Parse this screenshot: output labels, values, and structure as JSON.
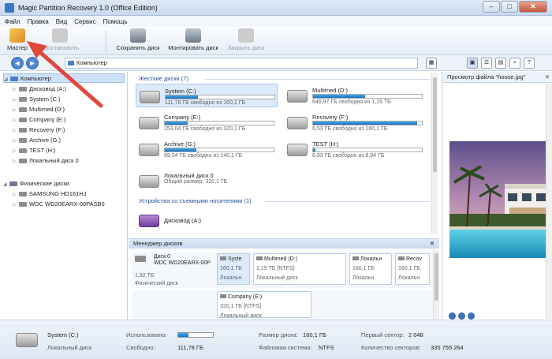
{
  "title": "Magic Partition Recovery 1.0 (Office Edition)",
  "menu": [
    "Файл",
    "Правка",
    "Вид",
    "Сервис",
    "Помощь"
  ],
  "toolbar": {
    "master": "Мастер",
    "restore": "Восстановить",
    "save_disk": "Сохранить диск",
    "mount_disk": "Монтировать диск",
    "close_disk": "Закрыть диск"
  },
  "address": "Компьютер",
  "tree": {
    "computer": "Компьютер",
    "items": [
      "Дисковод (A:)",
      "System (C:)",
      "Multimed (D:)",
      "Company (E:)",
      "Recovery (F:)",
      "Archive (G:)",
      "TEST (H:)",
      "Локальный диск 0"
    ],
    "physical": "Физические диски",
    "physical_items": [
      "SAMSUNG HD161HJ",
      "WDC WD20EARX-00PASB0"
    ]
  },
  "sections": {
    "hard": "Жесткие диски (7)",
    "removable": "Устройства со съемными носителями (1)"
  },
  "drives": [
    {
      "name": "System (C:)",
      "info": "111,78 ГБ свободно из 160,1 ГБ",
      "used": 0.3
    },
    {
      "name": "Multimed (D:)",
      "info": "646,97 ГБ свободно из 1,19 ТБ",
      "used": 0.48
    },
    {
      "name": "Company (E:)",
      "info": "253,04 ГБ свободно из 320,1 ГБ",
      "used": 0.21
    },
    {
      "name": "Recovery (F:)",
      "info": "6,53 ГБ свободно из 160,1 ГБ",
      "used": 0.96
    },
    {
      "name": "Archive (G:)",
      "info": "99,54 ГБ свободно из 140,1 ГБ",
      "used": 0.29
    },
    {
      "name": "TEST (H:)",
      "info": "8,93 ГБ свободно из 8,94 ГБ",
      "used": 0.02
    },
    {
      "name": "Локальный диск 0",
      "info": "Общий размер: 320,1 ГБ"
    }
  ],
  "removable_drive": "Дисковод (A:)",
  "preview": {
    "title": "Просмотр файла \"house.jpg\""
  },
  "disk_manager": {
    "title": "Менеджер дисков",
    "disk": {
      "name": "Диск 0",
      "model": "WDC WD20EARX-00P",
      "size": "1,82 ТБ",
      "type": "Физический диск"
    },
    "partitions": [
      {
        "name": "Syste",
        "size": "160,1 ГБ",
        "type": "Локальн"
      },
      {
        "name": "Multimed (D:)",
        "size": "1,19 ТБ [NTFS]",
        "type": "Локальный диск"
      },
      {
        "name": "Локальн",
        "size": "160,1 ГБ",
        "type": "Локальн"
      },
      {
        "name": "Recov",
        "size": "160,1 ГБ",
        "type": "Локальн"
      },
      {
        "name": "Company (E:)",
        "size": "320,1 ГБ [NTFS]",
        "type": "Локальный диск"
      }
    ]
  },
  "status": {
    "name": "System (C:)",
    "type": "Локальный диск",
    "used_label": "Использовано:",
    "used": 0.3,
    "free_label": "Свободно:",
    "free": "111,78 ГБ",
    "size_label": "Размер диска:",
    "size": "160,1 ГБ",
    "fs_label": "Файловая система:",
    "fs": "NTFS",
    "first_label": "Первый сектор:",
    "first": "2 048",
    "count_label": "Количество секторов:",
    "count": "335 755 264"
  },
  "colors": {
    "accent": "#1a6fc2",
    "arrow": "#e0473c",
    "section_header": "#1f4f9f"
  }
}
